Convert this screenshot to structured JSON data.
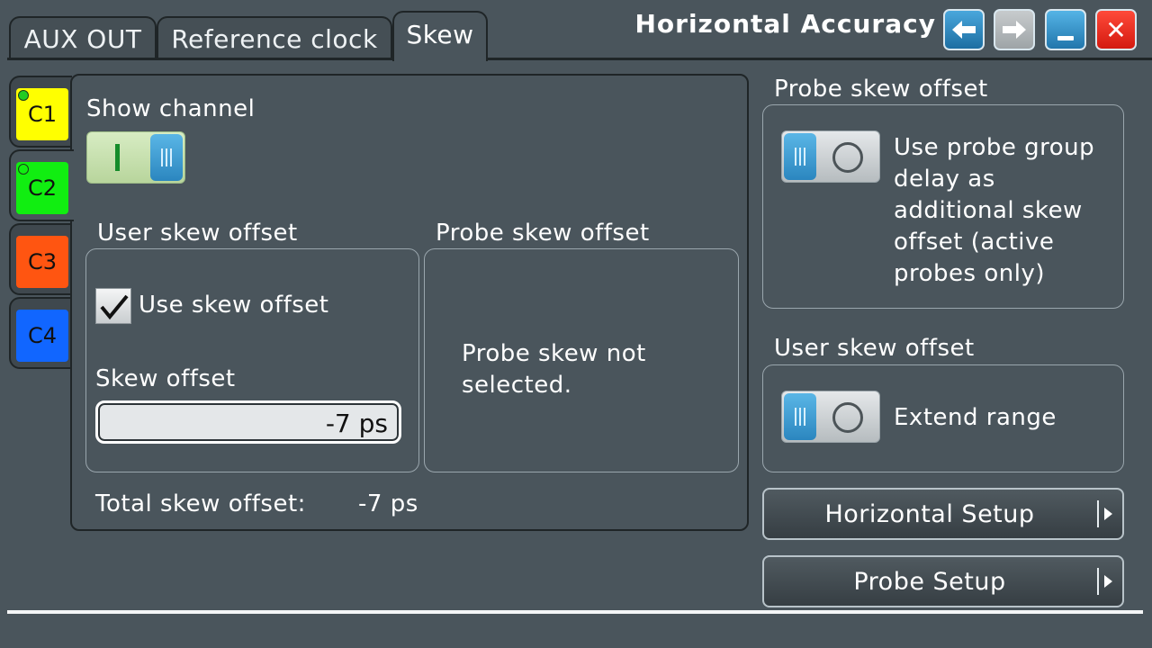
{
  "tabs": [
    {
      "label": "AUX OUT"
    },
    {
      "label": "Reference clock"
    },
    {
      "label": "Skew"
    }
  ],
  "title": "Horizontal Accuracy",
  "window_buttons": {
    "back_icon": "arrow-left-icon",
    "forward_icon": "arrow-right-icon",
    "minimize_icon": "minimize-icon",
    "close_icon": "close-icon",
    "close_glyph": "✕"
  },
  "channels": [
    {
      "label": "C1",
      "color": "#ffff00",
      "active_dot": true
    },
    {
      "label": "C2",
      "color": "#11ee11",
      "active_dot": true
    },
    {
      "label": "C3",
      "color": "#ff5511",
      "active_dot": false
    },
    {
      "label": "C4",
      "color": "#1166ff",
      "active_dot": false
    }
  ],
  "channel_panel": {
    "show_channel_label": "Show channel",
    "show_channel_on": true,
    "user_skew_title": "User skew offset",
    "use_skew_label": "Use skew offset",
    "use_skew_checked": true,
    "skew_offset_label": "Skew offset",
    "skew_offset_value": "-7 ps",
    "probe_skew_title": "Probe skew offset",
    "probe_skew_message_line1": "Probe skew not",
    "probe_skew_message_line2": "selected.",
    "total_label": "Total skew offset:",
    "total_value": "-7 ps"
  },
  "right_panel": {
    "probe_skew_title": "Probe skew offset",
    "probe_group_delay_lines": [
      "Use probe group",
      "delay as",
      "additional skew",
      "offset (active",
      "probes only)"
    ],
    "probe_group_delay_on": false,
    "user_skew_title": "User skew offset",
    "extend_range_label": "Extend range",
    "extend_range_on": false,
    "horizontal_setup_label": "Horizontal Setup",
    "probe_setup_label": "Probe Setup"
  },
  "colors": {
    "background": "#4a555c",
    "accent_blue": "#2b86bf",
    "close_red": "#e8271b"
  }
}
